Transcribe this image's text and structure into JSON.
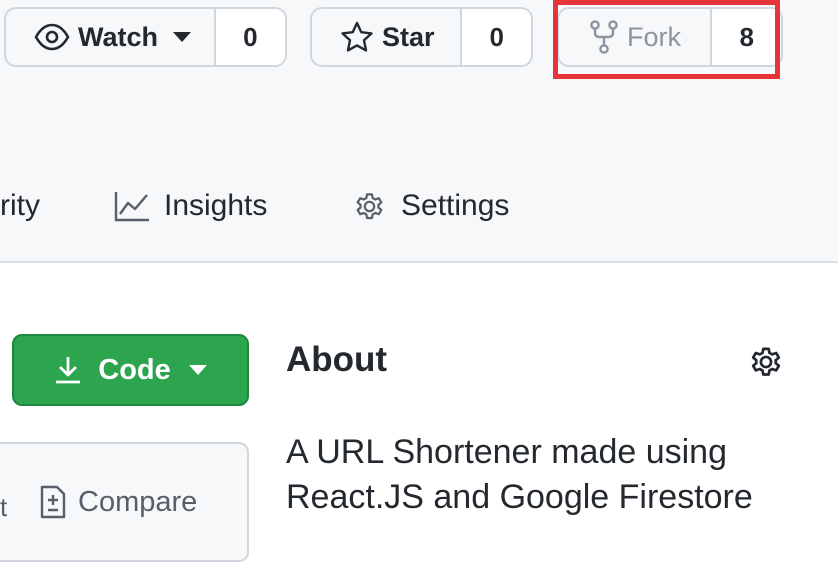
{
  "header": {
    "watch": {
      "label": "Watch",
      "count": "0",
      "icon": "eye-icon"
    },
    "star": {
      "label": "Star",
      "count": "0",
      "icon": "star-icon"
    },
    "fork": {
      "label": "Fork",
      "count": "8",
      "icon": "fork-icon"
    }
  },
  "nav": {
    "security_partial": "rity",
    "insights": "Insights",
    "settings": "Settings"
  },
  "code_button": {
    "label": "Code",
    "icon": "download-icon"
  },
  "file_panel": {
    "compare_label": "Compare",
    "partial_char": "t"
  },
  "about": {
    "title": "About",
    "description": "A URL Shortener made using React.JS and Google Firestore"
  },
  "colors": {
    "highlight": "#e5353a",
    "code_button": "#2da44e",
    "background": "#f6f8fa"
  }
}
